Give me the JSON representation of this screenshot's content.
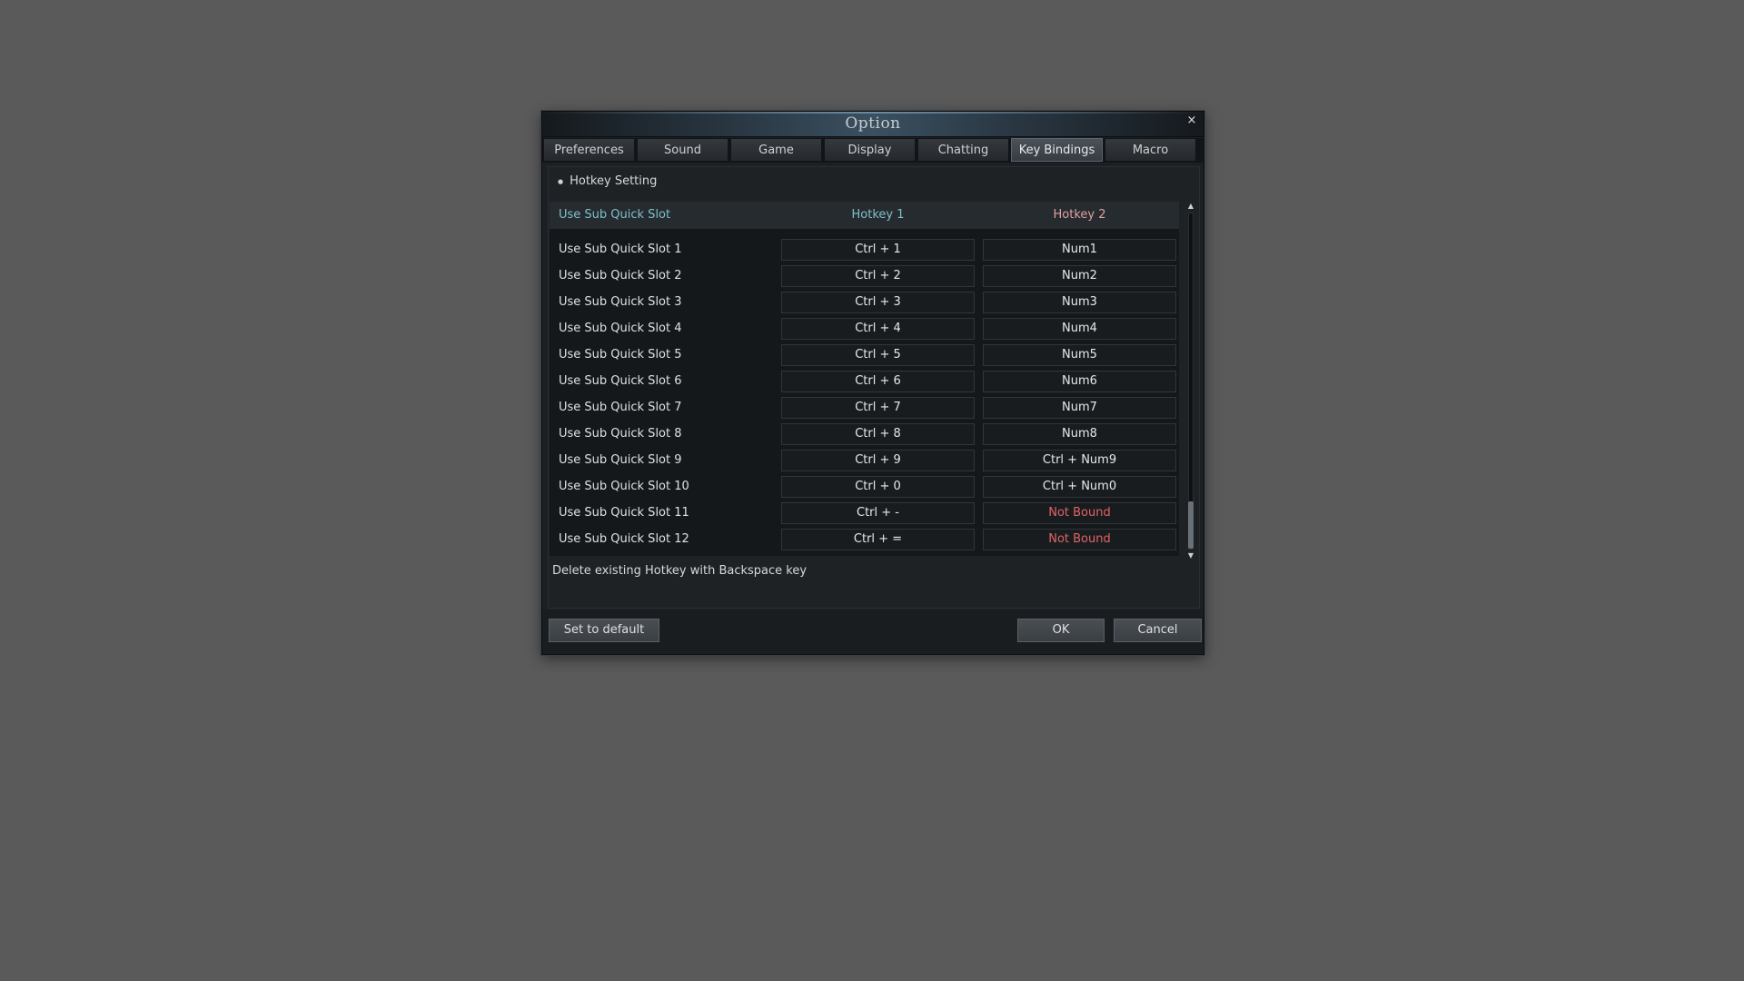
{
  "window": {
    "title": "Option",
    "close_symbol": "×"
  },
  "tabs": [
    {
      "label": "Preferences",
      "active": false
    },
    {
      "label": "Sound",
      "active": false
    },
    {
      "label": "Game",
      "active": false
    },
    {
      "label": "Display",
      "active": false
    },
    {
      "label": "Chatting",
      "active": false
    },
    {
      "label": "Key Bindings",
      "active": true
    },
    {
      "label": "Macro",
      "active": false
    }
  ],
  "section": {
    "title": "Hotkey Setting"
  },
  "table": {
    "header": {
      "action": "Use Sub Quick Slot",
      "hotkey1": "Hotkey 1",
      "hotkey2": "Hotkey 2"
    },
    "rows": [
      {
        "label": "Use Sub Quick Slot 1",
        "hotkey1": "Ctrl  +  1",
        "hotkey2": "Num1"
      },
      {
        "label": "Use Sub Quick Slot 2",
        "hotkey1": "Ctrl  +  2",
        "hotkey2": "Num2"
      },
      {
        "label": "Use Sub Quick Slot 3",
        "hotkey1": "Ctrl  +  3",
        "hotkey2": "Num3"
      },
      {
        "label": "Use Sub Quick Slot 4",
        "hotkey1": "Ctrl  +  4",
        "hotkey2": "Num4"
      },
      {
        "label": "Use Sub Quick Slot 5",
        "hotkey1": "Ctrl  +  5",
        "hotkey2": "Num5"
      },
      {
        "label": "Use Sub Quick Slot 6",
        "hotkey1": "Ctrl  +  6",
        "hotkey2": "Num6"
      },
      {
        "label": "Use Sub Quick Slot 7",
        "hotkey1": "Ctrl  +  7",
        "hotkey2": "Num7"
      },
      {
        "label": "Use Sub Quick Slot 8",
        "hotkey1": "Ctrl  +  8",
        "hotkey2": "Num8"
      },
      {
        "label": "Use Sub Quick Slot 9",
        "hotkey1": "Ctrl  +  9",
        "hotkey2": "Ctrl  +  Num9"
      },
      {
        "label": "Use Sub Quick Slot 10",
        "hotkey1": "Ctrl  +  0",
        "hotkey2": "Ctrl  +  Num0"
      },
      {
        "label": "Use Sub Quick Slot 11",
        "hotkey1": "Ctrl  +  -",
        "hotkey2": "Not Bound"
      },
      {
        "label": "Use Sub Quick Slot 12",
        "hotkey1": "Ctrl  +  =",
        "hotkey2": "Not Bound"
      }
    ]
  },
  "hint": "Delete existing Hotkey with Backspace key",
  "buttons": {
    "set_default": "Set to default",
    "ok": "OK",
    "cancel": "Cancel"
  },
  "colors": {
    "header_accent": "#7fc0c8",
    "hotkey2_header": "#e0a0a0",
    "not_bound": "#e06464"
  }
}
